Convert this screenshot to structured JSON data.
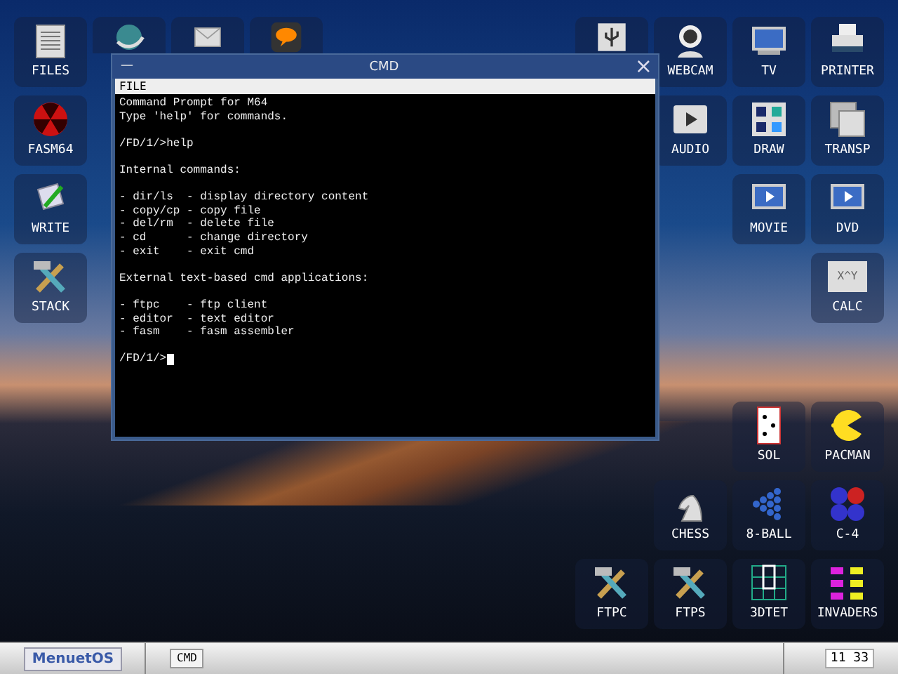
{
  "desktop_icons": [
    {
      "label": "FILES",
      "kind": "document"
    },
    {
      "label": "FASM64",
      "kind": "radiation"
    },
    {
      "label": "WRITE",
      "kind": "scroll"
    },
    {
      "label": "STACK",
      "kind": "tools"
    },
    {
      "kind": "globe"
    },
    {
      "kind": "envelope"
    },
    {
      "kind": "chat"
    },
    {
      "kind": "usb"
    },
    {
      "label": "WEBCAM",
      "kind": "webcam"
    },
    {
      "label": "TV",
      "kind": "monitor"
    },
    {
      "label": "PRINTER",
      "kind": "printer"
    },
    {
      "label": "AUDIO",
      "kind": "play"
    },
    {
      "label": "DRAW",
      "kind": "palette"
    },
    {
      "label": "TRANSP",
      "kind": "windows"
    },
    {
      "label": "MOVIE",
      "kind": "video"
    },
    {
      "label": "DVD",
      "kind": "video"
    },
    {
      "label": "CALC",
      "kind": "calculator",
      "glyph": "X^Y"
    },
    {
      "label": "SOL",
      "kind": "card"
    },
    {
      "label": "PACMAN",
      "kind": "pacman"
    },
    {
      "label": "CHESS",
      "kind": "knight"
    },
    {
      "label": "8-BALL",
      "kind": "balls"
    },
    {
      "label": "C-4",
      "kind": "dots"
    },
    {
      "label": "FTPC",
      "kind": "tools"
    },
    {
      "label": "FTPS",
      "kind": "tools"
    },
    {
      "label": "3DTET",
      "kind": "blocks"
    },
    {
      "label": "INVADERS",
      "kind": "aliens"
    }
  ],
  "window": {
    "title": "CMD",
    "minimize": "—",
    "close": "×",
    "menu": [
      "FILE"
    ],
    "terminal": [
      [
        "Command Prompt for M64",
        "Type 'help' for commands."
      ],
      [
        "/FD/1/>help"
      ],
      [
        "Internal commands:"
      ],
      [
        "- dir/ls  - display directory content",
        "- copy/cp - copy file",
        "- del/rm  - delete file",
        "- cd      - change directory",
        "- exit    - exit cmd"
      ],
      [
        "External text-based cmd applications:"
      ],
      [
        "- ftpc    - ftp client",
        "- editor  - text editor",
        "- fasm    - fasm assembler"
      ],
      [
        "/FD/1/>"
      ]
    ]
  },
  "taskbar": {
    "start": "MenuetOS",
    "tasks": [
      {
        "label": "CMD"
      }
    ],
    "clock": "11 33"
  }
}
